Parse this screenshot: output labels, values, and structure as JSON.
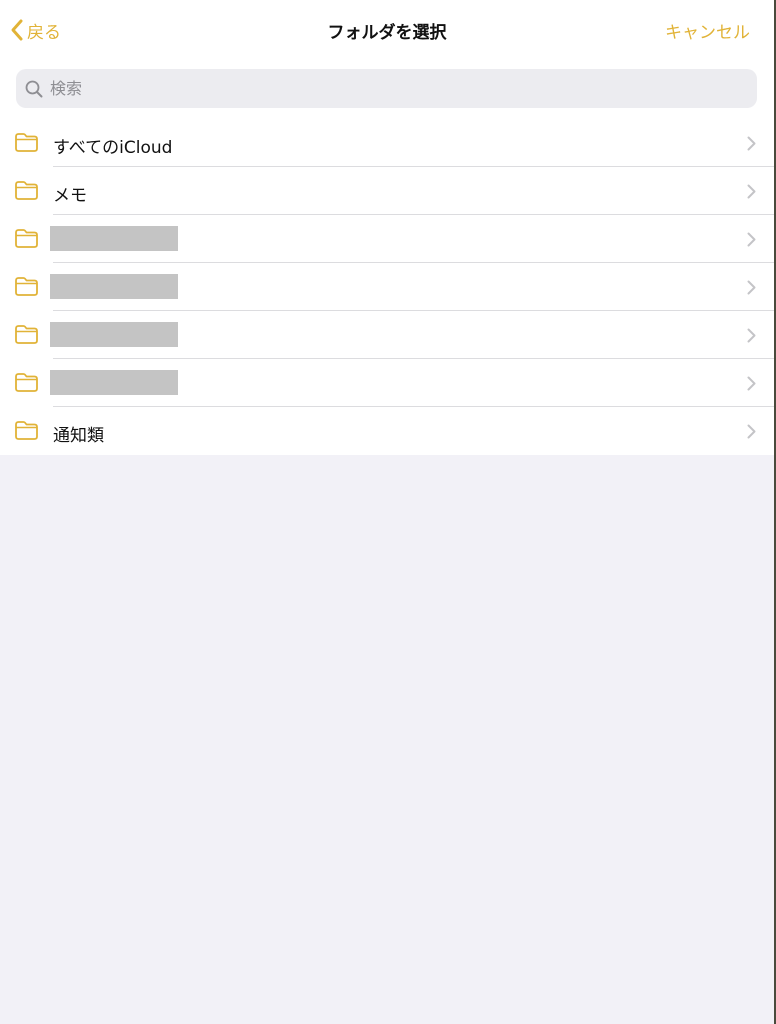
{
  "navbar": {
    "back_label": "戻る",
    "title": "フォルダを選択",
    "cancel_label": "キャンセル"
  },
  "search": {
    "placeholder": "検索"
  },
  "folders": [
    {
      "name": "すべてのiCloud",
      "redacted": false
    },
    {
      "name": "メモ",
      "redacted": false
    },
    {
      "name": "",
      "redacted": true
    },
    {
      "name": "",
      "redacted": true
    },
    {
      "name": "",
      "redacted": true
    },
    {
      "name": "",
      "redacted": true
    },
    {
      "name": "通知類",
      "redacted": false
    }
  ],
  "colors": {
    "accent": "#e1b337",
    "panel": "#ffffff",
    "background": "#f2f1f7",
    "search_field": "#ececf0",
    "separator": "#dcdcdf",
    "redaction": "#c4c4c4"
  },
  "icons": {
    "back": "chevron-left-icon",
    "search": "magnifying-glass-icon",
    "folder": "folder-icon",
    "disclosure": "chevron-right-icon"
  }
}
